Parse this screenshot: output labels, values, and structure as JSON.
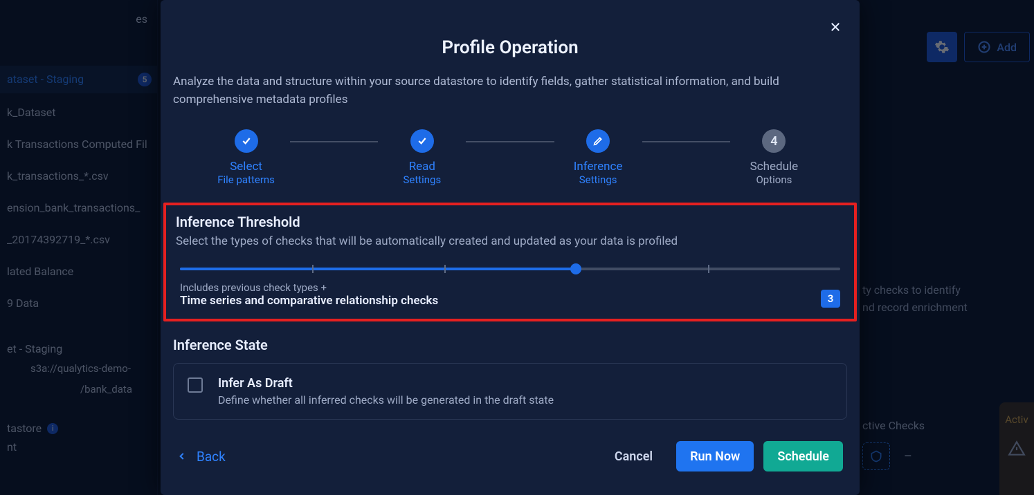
{
  "header": {
    "add_label": "Add"
  },
  "sidebar": {
    "top_label": "es",
    "items": [
      {
        "label": "ataset - Staging",
        "badge": "5"
      },
      {
        "label": "k_Dataset"
      },
      {
        "label": "k Transactions Computed Fil"
      },
      {
        "label": "k_transactions_*.csv"
      },
      {
        "label": "ension_bank_transactions_"
      },
      {
        "label": "_20174392719_*.csv"
      },
      {
        "label": "lated Balance"
      },
      {
        "label": "9 Data"
      }
    ],
    "group_header": "et - Staging",
    "group_path1": "s3a://qualytics-demo-",
    "group_path2": "/bank_data",
    "section": "tastore",
    "section_sub": "nt"
  },
  "bg": {
    "desc": "ty checks to identify\nnd record enrichment",
    "stat_label": "ctive Checks",
    "stat_value": "–",
    "right_label": "Activ"
  },
  "modal": {
    "title": "Profile Operation",
    "description": "Analyze the data and structure within your source datastore to identify fields, gather statistical information, and build comprehensive metadata profiles",
    "steps": [
      {
        "l1": "Select",
        "l2": "File patterns",
        "state": "done"
      },
      {
        "l1": "Read",
        "l2": "Settings",
        "state": "done"
      },
      {
        "l1": "Inference",
        "l2": "Settings",
        "state": "current"
      },
      {
        "l1": "Schedule",
        "l2": "Options",
        "state": "pending",
        "num": "4"
      }
    ],
    "threshold": {
      "title": "Inference Threshold",
      "desc": "Select the types of checks that will be automatically created and updated as your data is profiled",
      "caption1": "Includes previous check types +",
      "caption2": "Time series and comparative relationship checks",
      "value": "3"
    },
    "state": {
      "title": "Inference State",
      "opt_title": "Infer As Draft",
      "opt_desc": "Define whether all inferred checks will be generated in the draft state"
    },
    "footer": {
      "back": "Back",
      "cancel": "Cancel",
      "run": "Run Now",
      "schedule": "Schedule"
    }
  }
}
